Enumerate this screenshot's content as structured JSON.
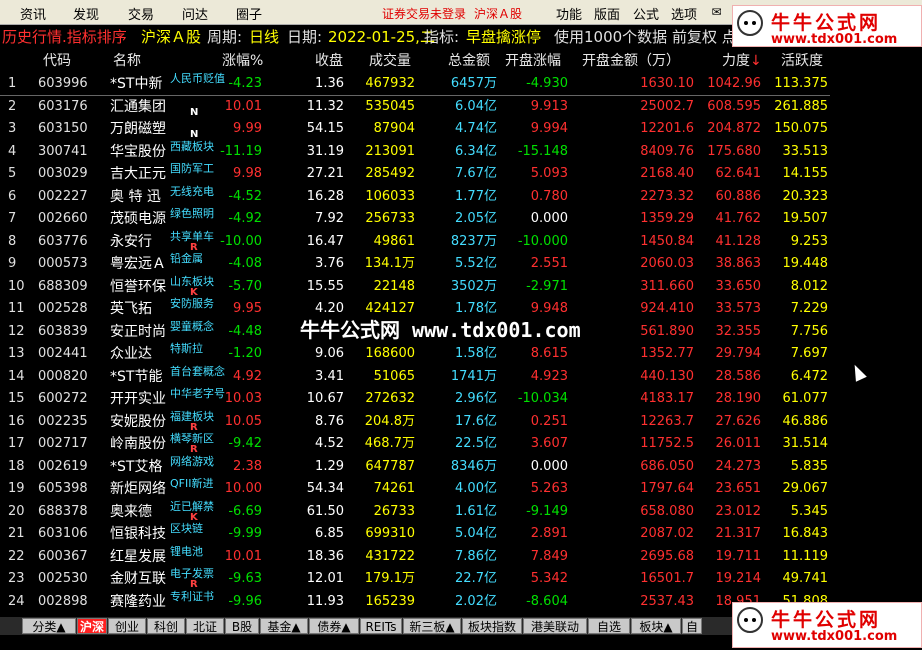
{
  "menu": {
    "items": [
      "资讯",
      "发现",
      "交易",
      "问达",
      "圈子"
    ],
    "right_items": [
      "功能",
      "版面",
      "公式",
      "选项"
    ],
    "status_login": "证券交易未登录",
    "status_market": "沪深Ａ股"
  },
  "infobar": {
    "mode": "历史行情.指标排序",
    "market": "沪深Ａ股",
    "period_label": "周期:",
    "period": "日线",
    "date_label": "日期:",
    "date": "2022-01-25,二",
    "indicator_label": "指标:",
    "indicator": "早盘擒涨停",
    "data_note": "使用1000个数据 前复权 点"
  },
  "colors": {
    "red": "#ff3030",
    "green": "#00e000",
    "yellow": "#ffff00",
    "cyan": "#44ddff",
    "white": "#ffffff",
    "flag_white": "#ffffff",
    "flag_red": "#ff4040"
  },
  "table": {
    "columns": [
      "代码",
      "名称",
      "涨幅%",
      "收盘",
      "成交量",
      "总金额",
      "开盘涨幅",
      "开盘金额（万）",
      "力度",
      "活跃度"
    ],
    "sort_arrow": "↓",
    "rows": [
      {
        "idx": "1",
        "code": "603996",
        "name": "*ST中新",
        "tag": "人民币贬值",
        "flag": "",
        "pct": "-4.23",
        "close": "1.36",
        "vol": "467932",
        "amt_num": "6457",
        "amt_unit": "万",
        "open_pct": "-4.930",
        "open_amt": "1630.10",
        "force": "1042.96",
        "active": "113.375"
      },
      {
        "idx": "2",
        "code": "603176",
        "name": "汇通集团",
        "tag": "",
        "flag": "N",
        "pct": "10.01",
        "close": "11.32",
        "vol": "535045",
        "amt_num": "6.04",
        "amt_unit": "亿",
        "open_pct": "9.913",
        "open_amt": "25002.7",
        "force": "608.595",
        "active": "261.885"
      },
      {
        "idx": "3",
        "code": "603150",
        "name": "万朗磁塑",
        "tag": "",
        "flag": "N",
        "pct": "9.99",
        "close": "54.15",
        "vol": "87904",
        "amt_num": "4.74",
        "amt_unit": "亿",
        "open_pct": "9.994",
        "open_amt": "12201.6",
        "force": "204.872",
        "active": "150.075"
      },
      {
        "idx": "4",
        "code": "300741",
        "name": "华宝股份",
        "tag": "西藏板块",
        "flag": "",
        "pct": "-11.19",
        "close": "31.19",
        "vol": "213091",
        "amt_num": "6.34",
        "amt_unit": "亿",
        "open_pct": "-15.148",
        "open_amt": "8409.76",
        "force": "175.680",
        "active": "33.513"
      },
      {
        "idx": "5",
        "code": "003029",
        "name": "吉大正元",
        "tag": "国防军工",
        "flag": "",
        "pct": "9.98",
        "close": "27.21",
        "vol": "285492",
        "amt_num": "7.67",
        "amt_unit": "亿",
        "open_pct": "5.093",
        "open_amt": "2168.40",
        "force": "62.641",
        "active": "14.155"
      },
      {
        "idx": "6",
        "code": "002227",
        "name": "奥 特 迅",
        "tag": "无线充电",
        "flag": "",
        "pct": "-4.52",
        "close": "16.28",
        "vol": "106033",
        "amt_num": "1.77",
        "amt_unit": "亿",
        "open_pct": "0.780",
        "open_amt": "2273.32",
        "force": "60.886",
        "active": "20.323"
      },
      {
        "idx": "7",
        "code": "002660",
        "name": "茂硕电源",
        "tag": "绿色照明",
        "flag": "",
        "pct": "-4.92",
        "close": "7.92",
        "vol": "256733",
        "amt_num": "2.05",
        "amt_unit": "亿",
        "open_pct": "0.000",
        "open_amt": "1359.29",
        "force": "41.762",
        "active": "19.507"
      },
      {
        "idx": "8",
        "code": "603776",
        "name": "永安行",
        "tag": "共享单车",
        "flag": "R",
        "pct": "-10.00",
        "close": "16.47",
        "vol": "49861",
        "amt_num": "8237",
        "amt_unit": "万",
        "open_pct": "-10.000",
        "open_amt": "1450.84",
        "force": "41.128",
        "active": "9.253"
      },
      {
        "idx": "9",
        "code": "000573",
        "name": "粤宏远Ａ",
        "tag": "铅金属",
        "flag": "",
        "pct": "-4.08",
        "close": "3.76",
        "vol": "134.1",
        "vol_unit": "万",
        "amt_num": "5.52",
        "amt_unit": "亿",
        "open_pct": "2.551",
        "open_amt": "2060.03",
        "force": "38.863",
        "active": "19.448"
      },
      {
        "idx": "10",
        "code": "688309",
        "name": "恒誉环保",
        "tag": "山东板块",
        "flag": "K",
        "pct": "-5.70",
        "close": "15.55",
        "vol": "22148",
        "amt_num": "3502",
        "amt_unit": "万",
        "open_pct": "-2.971",
        "open_amt": "311.660",
        "force": "33.650",
        "active": "8.012"
      },
      {
        "idx": "11",
        "code": "002528",
        "name": "英飞拓",
        "tag": "安防服务",
        "flag": "",
        "pct": "9.95",
        "close": "4.20",
        "vol": "424127",
        "amt_num": "1.78",
        "amt_unit": "亿",
        "open_pct": "9.948",
        "open_amt": "924.410",
        "force": "33.573",
        "active": "7.229"
      },
      {
        "idx": "12",
        "code": "603839",
        "name": "安正时尚",
        "tag": "婴童概念",
        "flag": "",
        "pct": "-4.48",
        "close": "",
        "vol": "",
        "amt_num": "",
        "amt_unit": "",
        "open_pct": "",
        "open_amt": "561.890",
        "force": "32.355",
        "active": "7.756"
      },
      {
        "idx": "13",
        "code": "002441",
        "name": "众业达",
        "tag": "特斯拉",
        "flag": "",
        "pct": "-1.20",
        "close": "9.06",
        "vol": "168600",
        "amt_num": "1.58",
        "amt_unit": "亿",
        "open_pct": "8.615",
        "open_amt": "1352.77",
        "force": "29.794",
        "active": "7.697"
      },
      {
        "idx": "14",
        "code": "000820",
        "name": "*ST节能",
        "tag": "首台套概念",
        "flag": "",
        "pct": "4.92",
        "close": "3.41",
        "vol": "51065",
        "amt_num": "1741",
        "amt_unit": "万",
        "open_pct": "4.923",
        "open_amt": "440.130",
        "force": "28.586",
        "active": "6.472"
      },
      {
        "idx": "15",
        "code": "600272",
        "name": "开开实业",
        "tag": "中华老字号",
        "flag": "",
        "pct": "10.03",
        "close": "10.67",
        "vol": "272632",
        "amt_num": "2.96",
        "amt_unit": "亿",
        "open_pct": "-10.034",
        "open_amt": "4183.17",
        "force": "28.190",
        "active": "61.077"
      },
      {
        "idx": "16",
        "code": "002235",
        "name": "安妮股份",
        "tag": "福建板块",
        "flag": "R",
        "pct": "10.05",
        "close": "8.76",
        "vol": "204.8",
        "vol_unit": "万",
        "amt_num": "17.6",
        "amt_unit": "亿",
        "open_pct": "0.251",
        "open_amt": "12263.7",
        "force": "27.626",
        "active": "46.886"
      },
      {
        "idx": "17",
        "code": "002717",
        "name": "岭南股份",
        "tag": "横琴新区",
        "flag": "R",
        "pct": "-9.42",
        "close": "4.52",
        "vol": "468.7",
        "vol_unit": "万",
        "amt_num": "22.5",
        "amt_unit": "亿",
        "open_pct": "3.607",
        "open_amt": "11752.5",
        "force": "26.011",
        "active": "31.514"
      },
      {
        "idx": "18",
        "code": "002619",
        "name": "*ST艾格",
        "tag": "网络游戏",
        "flag": "",
        "pct": "2.38",
        "close": "1.29",
        "vol": "647787",
        "amt_num": "8346",
        "amt_unit": "万",
        "open_pct": "0.000",
        "open_amt": "686.050",
        "force": "24.273",
        "active": "5.835"
      },
      {
        "idx": "19",
        "code": "605398",
        "name": "新炬网络",
        "tag": "QFII新进",
        "flag": "",
        "pct": "10.00",
        "close": "54.34",
        "vol": "74261",
        "amt_num": "4.00",
        "amt_unit": "亿",
        "open_pct": "5.263",
        "open_amt": "1797.64",
        "force": "23.651",
        "active": "29.067"
      },
      {
        "idx": "20",
        "code": "688378",
        "name": "奥来德",
        "tag": "近已解禁",
        "flag": "K",
        "pct": "-6.69",
        "close": "61.50",
        "vol": "26733",
        "amt_num": "1.61",
        "amt_unit": "亿",
        "open_pct": "-9.149",
        "open_amt": "658.080",
        "force": "23.012",
        "active": "5.345"
      },
      {
        "idx": "21",
        "code": "603106",
        "name": "恒银科技",
        "tag": "区块链",
        "flag": "",
        "pct": "-9.99",
        "close": "6.85",
        "vol": "699310",
        "amt_num": "5.04",
        "amt_unit": "亿",
        "open_pct": "2.891",
        "open_amt": "2087.02",
        "force": "21.317",
        "active": "16.843"
      },
      {
        "idx": "22",
        "code": "600367",
        "name": "红星发展",
        "tag": "锂电池",
        "flag": "",
        "pct": "10.01",
        "close": "18.36",
        "vol": "431722",
        "amt_num": "7.86",
        "amt_unit": "亿",
        "open_pct": "7.849",
        "open_amt": "2695.68",
        "force": "19.711",
        "active": "11.119"
      },
      {
        "idx": "23",
        "code": "002530",
        "name": "金财互联",
        "tag": "电子发票",
        "flag": "R",
        "pct": "-9.63",
        "close": "12.01",
        "vol": "179.1",
        "vol_unit": "万",
        "amt_num": "22.7",
        "amt_unit": "亿",
        "open_pct": "5.342",
        "open_amt": "16501.7",
        "force": "19.214",
        "active": "49.741"
      },
      {
        "idx": "24",
        "code": "002898",
        "name": "赛隆药业",
        "tag": "专利证书",
        "flag": "",
        "pct": "-9.96",
        "close": "11.93",
        "vol": "165239",
        "amt_num": "2.02",
        "amt_unit": "亿",
        "open_pct": "-8.604",
        "open_amt": "2537.43",
        "force": "18.951",
        "active": "51.808"
      }
    ]
  },
  "watermark": "牛牛公式网 www.tdx001.com",
  "logo": {
    "title": "牛牛公式网",
    "url": "www.tdx001.com"
  },
  "tabs": [
    "分类▲",
    "沪深",
    "创业",
    "科创",
    "北证",
    "B股",
    "基金▲",
    "债券▲",
    "REITs",
    "新三板▲",
    "板块指数",
    "港美联动",
    "自选",
    "板块▲",
    "自"
  ]
}
